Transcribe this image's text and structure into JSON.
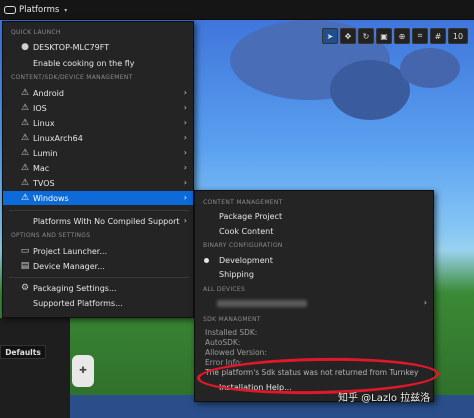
{
  "toolbar": {
    "platforms_label": "Platforms",
    "caret": "▾"
  },
  "viewport_tools": {
    "icons": [
      "cursor-icon",
      "move-icon",
      "rotate-icon",
      "scale-icon",
      "globe-icon",
      "snap-icon",
      "grid-icon"
    ],
    "number": "10"
  },
  "main_menu": {
    "quick_launch_title": "QUICK LAUNCH",
    "quick_launch": [
      {
        "label": "DESKTOP-MLC79FT",
        "icon": "device-dot-icon"
      },
      {
        "label": "Enable cooking on the fly",
        "icon": ""
      }
    ],
    "content_title": "CONTENT/SDK/DEVICE MANAGEMENT",
    "platforms": [
      {
        "label": "Android",
        "icon": "warning-icon"
      },
      {
        "label": "IOS",
        "icon": "warning-icon"
      },
      {
        "label": "Linux",
        "icon": "warning-icon"
      },
      {
        "label": "LinuxArch64",
        "icon": "warning-icon"
      },
      {
        "label": "Lumin",
        "icon": "warning-icon"
      },
      {
        "label": "Mac",
        "icon": "warning-icon"
      },
      {
        "label": "TVOS",
        "icon": "warning-icon"
      },
      {
        "label": "Windows",
        "icon": "warning-icon"
      }
    ],
    "no_compiled": "Platforms With No Compiled Support",
    "options_title": "OPTIONS AND SETTINGS",
    "options": [
      {
        "label": "Project Launcher...",
        "icon": "launcher-icon"
      },
      {
        "label": "Device Manager...",
        "icon": "device-manager-icon"
      }
    ],
    "packaging": [
      {
        "label": "Packaging Settings...",
        "icon": "settings-icon"
      },
      {
        "label": "Supported Platforms...",
        "icon": ""
      }
    ]
  },
  "submenu": {
    "content_title": "CONTENT MANAGEMENT",
    "content_items": [
      "Package Project",
      "Cook Content"
    ],
    "binary_title": "BINARY CONFIGURATION",
    "binary_items": [
      "Development",
      "Shipping"
    ],
    "devices_title": "ALL DEVICES",
    "sdk_title": "SDK MANAGMENT",
    "sdk_lines": [
      "Installed SDK:",
      "AutoSDK:",
      "Allowed Version:",
      "Error Info:"
    ],
    "error_message": "The platform's Sdk status was not returned from Turnkey",
    "installation_help": "Installation Help..."
  },
  "left_panel": {
    "defaults_label": "Defaults"
  },
  "watermark": "知乎 @Lazlo 拉兹洛",
  "colors": {
    "highlight": "#0d6ad9",
    "annotation": "#e0182a",
    "menu_bg": "#242424"
  }
}
